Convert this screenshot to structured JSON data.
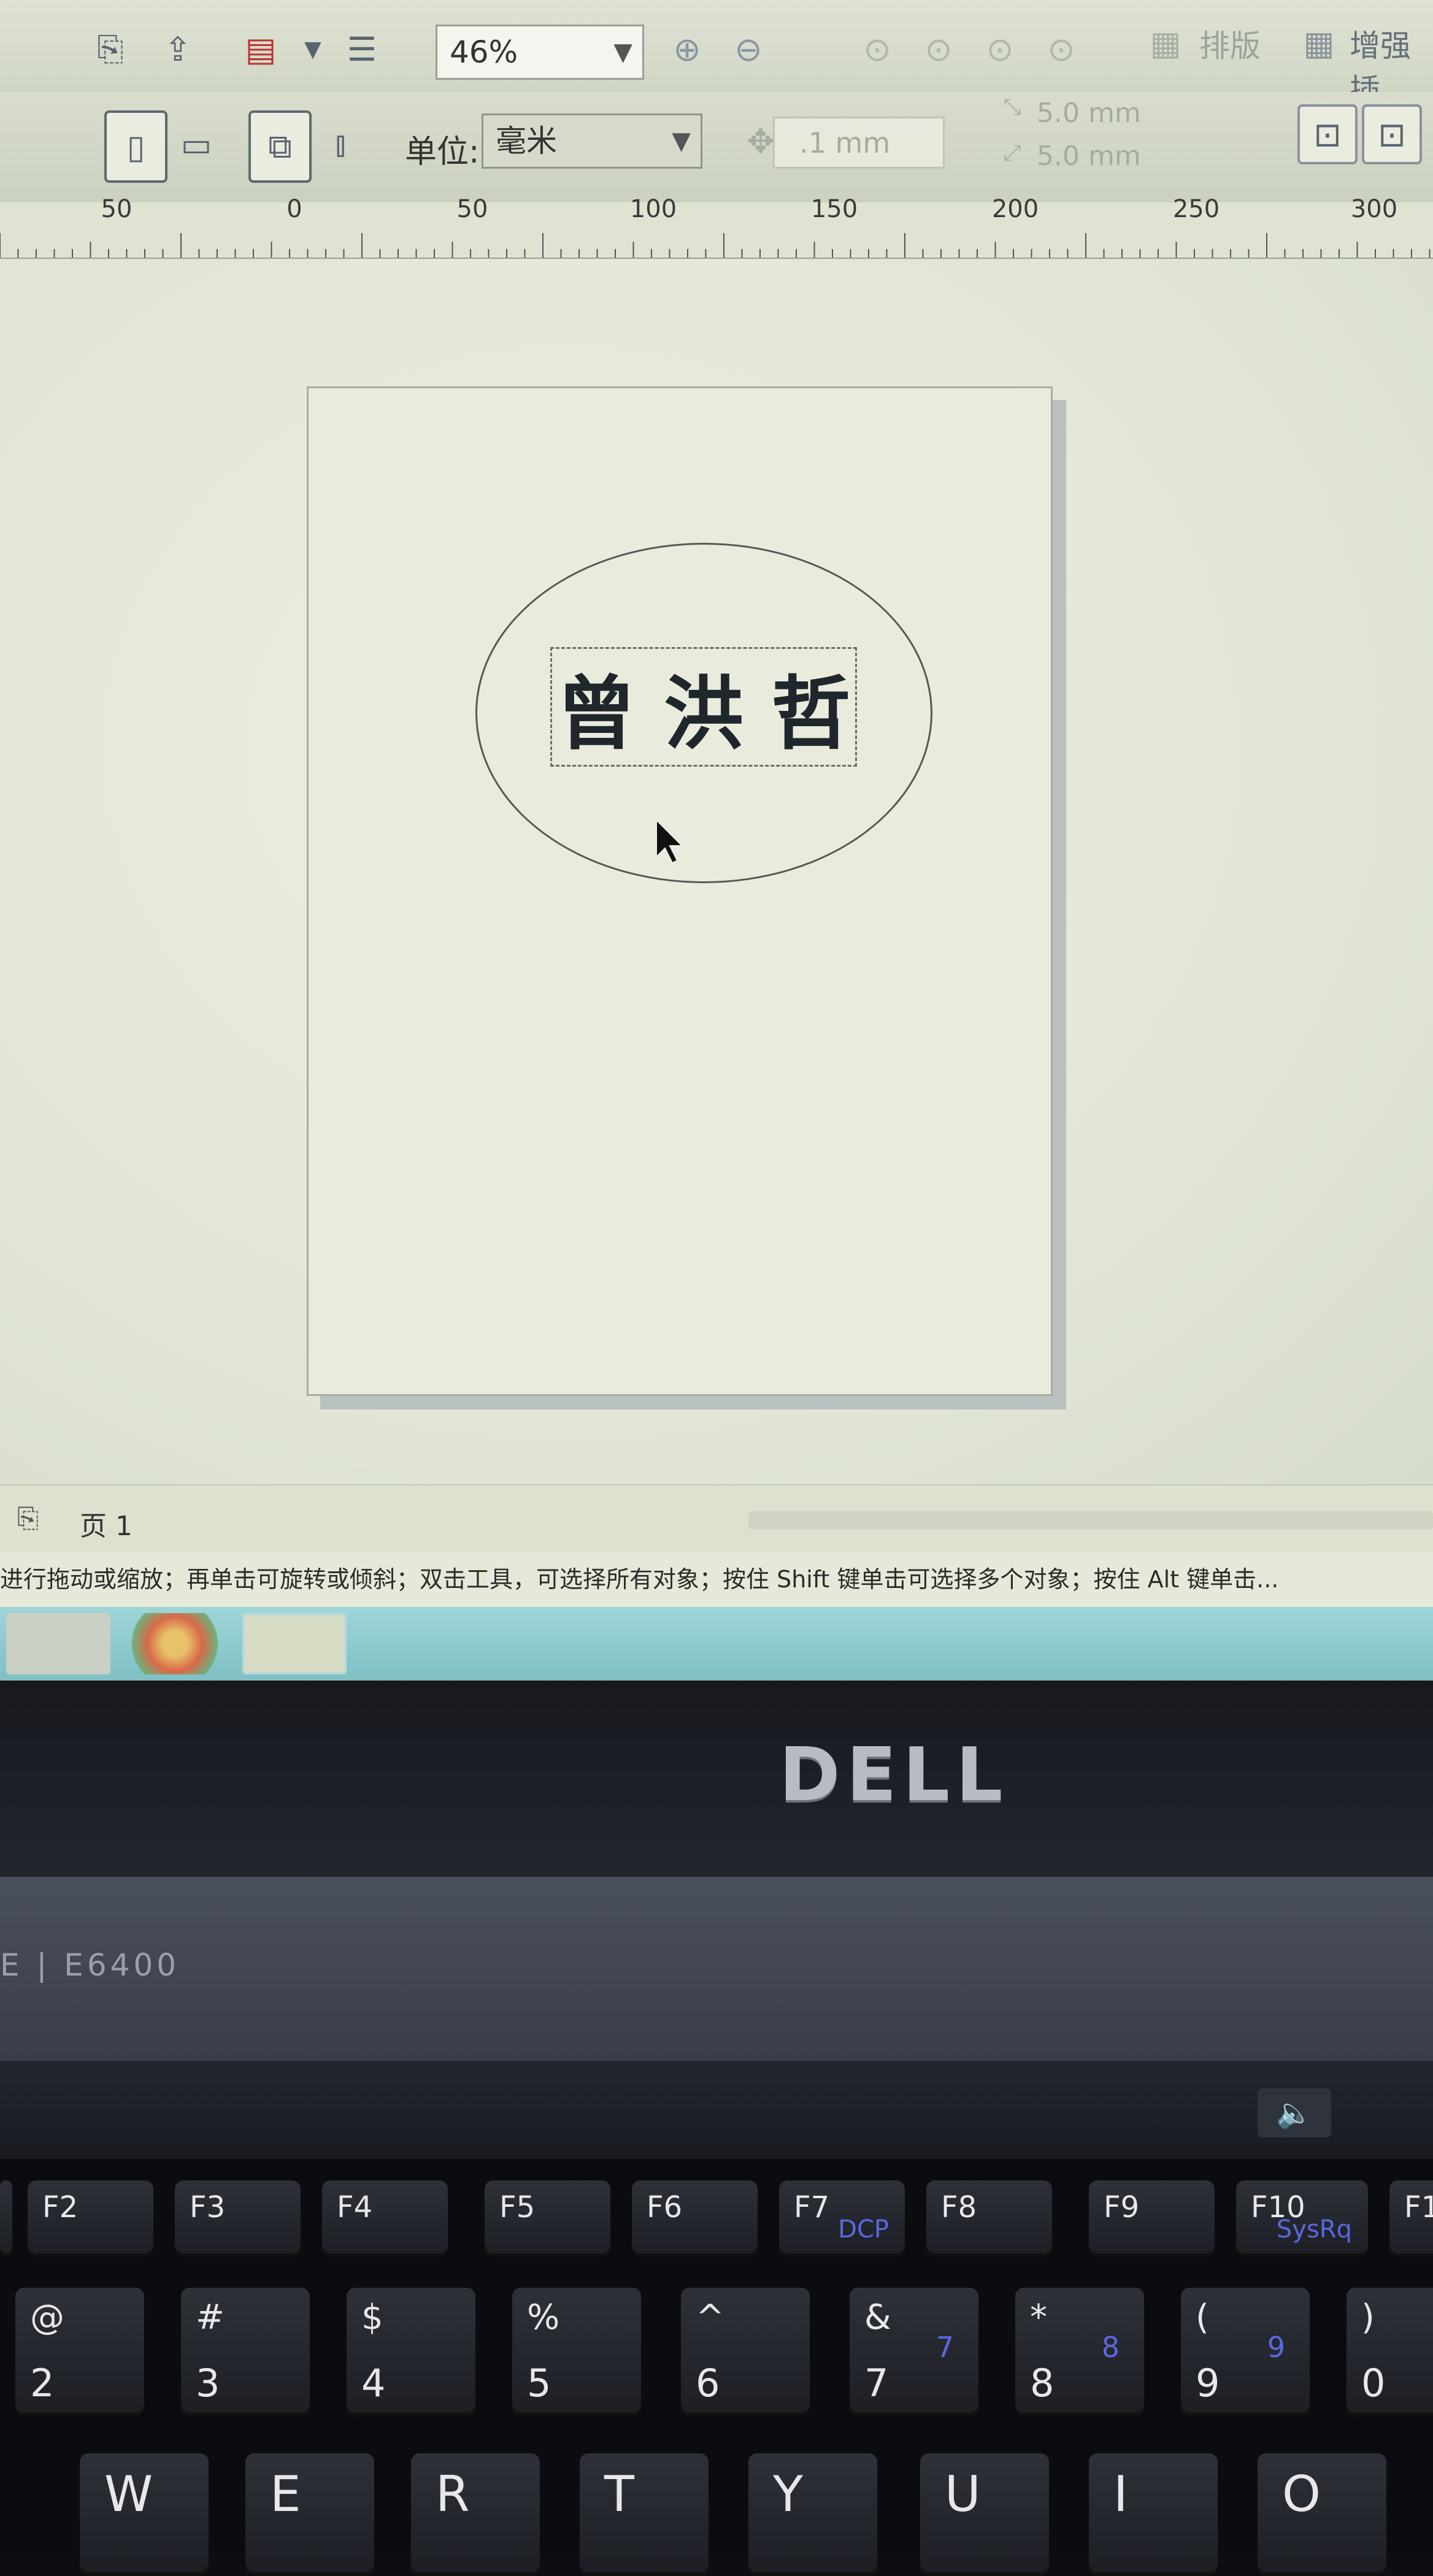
{
  "toolbar": {
    "zoom_value": "46%",
    "layout_label": "排版",
    "enhance_label": "增强插",
    "unit_label": "单位:",
    "unit_value": "毫米",
    "nudge_value": ".1 mm",
    "dup_x": "5.0 mm",
    "dup_y": "5.0 mm"
  },
  "ruler": {
    "labels": [
      "50",
      "0",
      "50",
      "100",
      "150",
      "200",
      "250",
      "300"
    ]
  },
  "document": {
    "text": "曾洪哲"
  },
  "page_tabs": {
    "current": "页 1"
  },
  "status_bar": {
    "hint": "进行拖动或缩放；再单击可旋转或倾斜；双击工具，可选择所有对象；按住 Shift 键单击可选择多个对象；按住 Alt 键单击..."
  },
  "laptop": {
    "brand": "DELL",
    "model": "E | E6400"
  },
  "keyboard": {
    "fkeys": [
      {
        "label": "F2",
        "sub": ""
      },
      {
        "label": "F3",
        "sub": ""
      },
      {
        "label": "F4",
        "sub": ""
      },
      {
        "label": "F5",
        "sub": ""
      },
      {
        "label": "F6",
        "sub": ""
      },
      {
        "label": "F7",
        "sub": "DCP"
      },
      {
        "label": "F8",
        "sub": ""
      },
      {
        "label": "F9",
        "sub": ""
      },
      {
        "label": "F10",
        "sub": "SysRq"
      },
      {
        "label": "F1",
        "sub": ""
      }
    ],
    "number_keys": [
      {
        "top": "@",
        "bottom": "2",
        "num": ""
      },
      {
        "top": "#",
        "bottom": "3",
        "num": ""
      },
      {
        "top": "$",
        "bottom": "4",
        "num": ""
      },
      {
        "top": "%",
        "bottom": "5",
        "num": ""
      },
      {
        "top": "^",
        "bottom": "6",
        "num": ""
      },
      {
        "top": "&",
        "bottom": "7",
        "num": "7"
      },
      {
        "top": "*",
        "bottom": "8",
        "num": "8"
      },
      {
        "top": "(",
        "bottom": "9",
        "num": "9"
      },
      {
        "top": ")",
        "bottom": "0",
        "num": ""
      }
    ],
    "letter_keys": [
      "W",
      "E",
      "R",
      "T",
      "Y",
      "U",
      "I",
      "O"
    ]
  },
  "colors": {
    "screen_background": "#e4e8d6",
    "taskbar": "#8ccbcf",
    "key_sub_label": "#5a68e0"
  }
}
